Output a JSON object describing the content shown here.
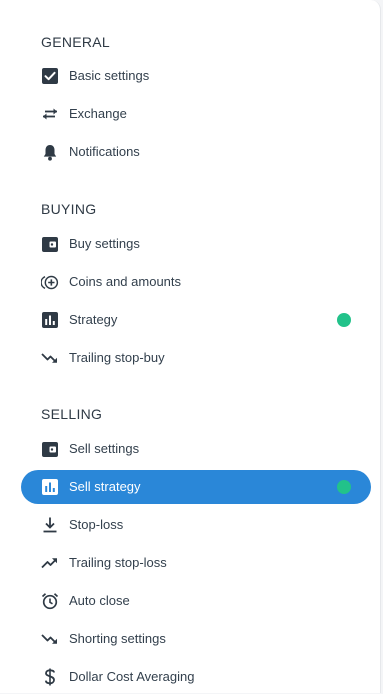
{
  "colors": {
    "accent": "#2a87d8",
    "status_dot": "#22c28a",
    "text": "#33404d"
  },
  "sections": {
    "general": {
      "title": "GENERAL",
      "items": [
        {
          "label": "Basic settings",
          "icon": "checkbox-icon"
        },
        {
          "label": "Exchange",
          "icon": "swap-arrows-icon"
        },
        {
          "label": "Notifications",
          "icon": "bell-icon"
        }
      ]
    },
    "buying": {
      "title": "BUYING",
      "items": [
        {
          "label": "Buy settings",
          "icon": "wallet-icon"
        },
        {
          "label": "Coins and amounts",
          "icon": "add-circle-icon"
        },
        {
          "label": "Strategy",
          "icon": "bar-chart-icon",
          "status": "active-dot"
        },
        {
          "label": "Trailing stop-buy",
          "icon": "trending-down-icon"
        }
      ]
    },
    "selling": {
      "title": "SELLING",
      "items": [
        {
          "label": "Sell settings",
          "icon": "wallet-icon"
        },
        {
          "label": "Sell strategy",
          "icon": "bar-chart-icon",
          "selected": true,
          "status": "active-dot"
        },
        {
          "label": "Stop-loss",
          "icon": "download-icon"
        },
        {
          "label": "Trailing stop-loss",
          "icon": "trending-up-icon"
        },
        {
          "label": "Auto close",
          "icon": "alarm-clock-icon"
        },
        {
          "label": "Shorting settings",
          "icon": "trending-down-icon"
        },
        {
          "label": "Dollar Cost Averaging",
          "icon": "dollar-icon"
        }
      ]
    }
  }
}
